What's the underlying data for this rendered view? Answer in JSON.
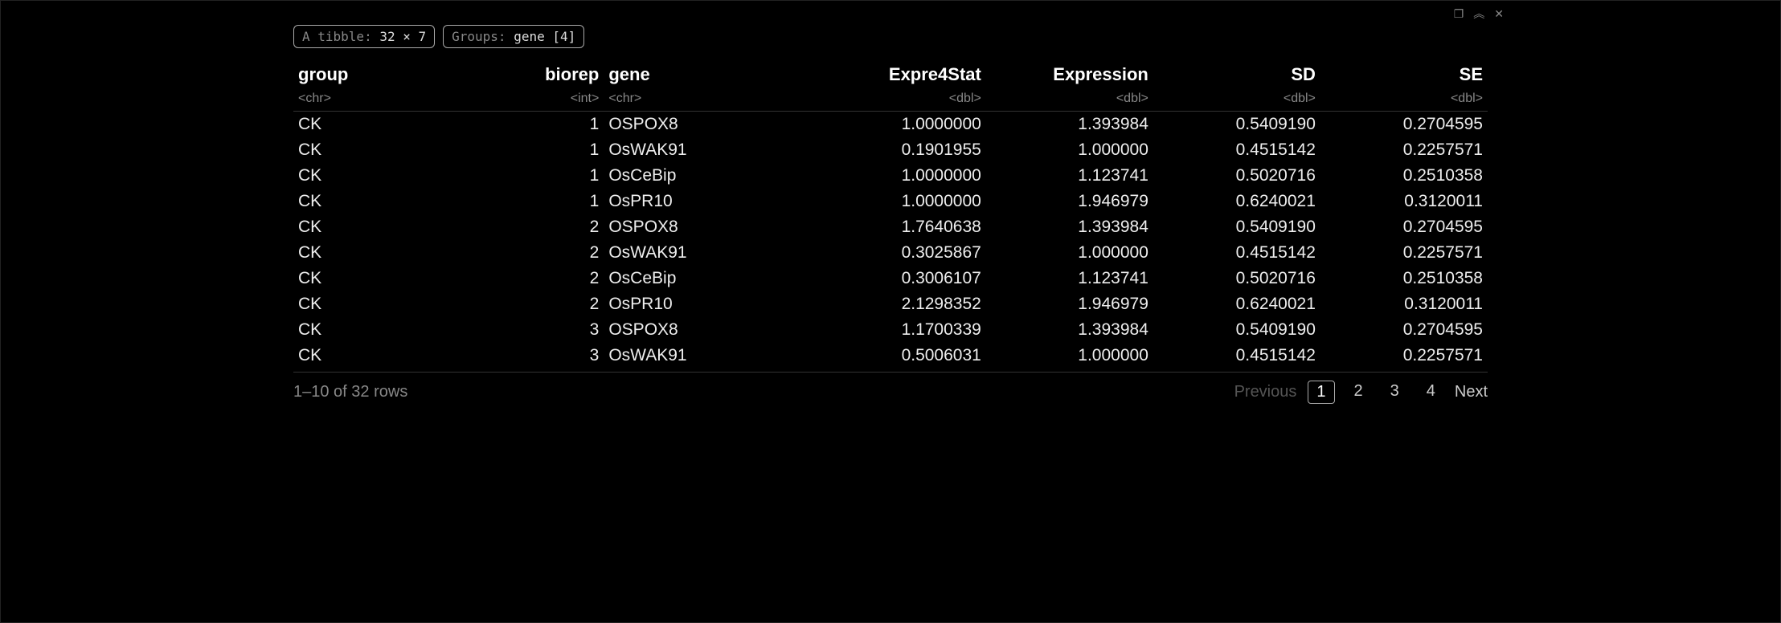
{
  "panelbar": {
    "popout_glyph": "❐",
    "collapse_glyph": "︽",
    "close_glyph": "✕"
  },
  "badges": {
    "tibble_prefix": "A tibble: ",
    "tibble_dims": "32 × 7",
    "groups_prefix": "Groups: ",
    "groups_value": "gene [4]"
  },
  "columns": [
    {
      "name": "group",
      "type": "<chr>",
      "align": "left"
    },
    {
      "name": "biorep",
      "type": "<int>",
      "align": "right"
    },
    {
      "name": "gene",
      "type": "<chr>",
      "align": "left"
    },
    {
      "name": "Expre4Stat",
      "type": "<dbl>",
      "align": "right"
    },
    {
      "name": "Expression",
      "type": "<dbl>",
      "align": "right"
    },
    {
      "name": "SD",
      "type": "<dbl>",
      "align": "right"
    },
    {
      "name": "SE",
      "type": "<dbl>",
      "align": "right"
    }
  ],
  "rows": [
    {
      "group": "CK",
      "biorep": "1",
      "gene": "OSPOX8",
      "Expre4Stat": "1.0000000",
      "Expression": "1.393984",
      "SD": "0.5409190",
      "SE": "0.2704595"
    },
    {
      "group": "CK",
      "biorep": "1",
      "gene": "OsWAK91",
      "Expre4Stat": "0.1901955",
      "Expression": "1.000000",
      "SD": "0.4515142",
      "SE": "0.2257571"
    },
    {
      "group": "CK",
      "biorep": "1",
      "gene": "OsCeBip",
      "Expre4Stat": "1.0000000",
      "Expression": "1.123741",
      "SD": "0.5020716",
      "SE": "0.2510358"
    },
    {
      "group": "CK",
      "biorep": "1",
      "gene": "OsPR10",
      "Expre4Stat": "1.0000000",
      "Expression": "1.946979",
      "SD": "0.6240021",
      "SE": "0.3120011"
    },
    {
      "group": "CK",
      "biorep": "2",
      "gene": "OSPOX8",
      "Expre4Stat": "1.7640638",
      "Expression": "1.393984",
      "SD": "0.5409190",
      "SE": "0.2704595"
    },
    {
      "group": "CK",
      "biorep": "2",
      "gene": "OsWAK91",
      "Expre4Stat": "0.3025867",
      "Expression": "1.000000",
      "SD": "0.4515142",
      "SE": "0.2257571"
    },
    {
      "group": "CK",
      "biorep": "2",
      "gene": "OsCeBip",
      "Expre4Stat": "0.3006107",
      "Expression": "1.123741",
      "SD": "0.5020716",
      "SE": "0.2510358"
    },
    {
      "group": "CK",
      "biorep": "2",
      "gene": "OsPR10",
      "Expre4Stat": "2.1298352",
      "Expression": "1.946979",
      "SD": "0.6240021",
      "SE": "0.3120011"
    },
    {
      "group": "CK",
      "biorep": "3",
      "gene": "OSPOX8",
      "Expre4Stat": "1.1700339",
      "Expression": "1.393984",
      "SD": "0.5409190",
      "SE": "0.2704595"
    },
    {
      "group": "CK",
      "biorep": "3",
      "gene": "OsWAK91",
      "Expre4Stat": "0.5006031",
      "Expression": "1.000000",
      "SD": "0.4515142",
      "SE": "0.2257571"
    }
  ],
  "pager": {
    "summary": "1–10 of 32 rows",
    "previous": "Previous",
    "next": "Next",
    "pages": [
      "1",
      "2",
      "3",
      "4"
    ],
    "current_index": 0
  }
}
